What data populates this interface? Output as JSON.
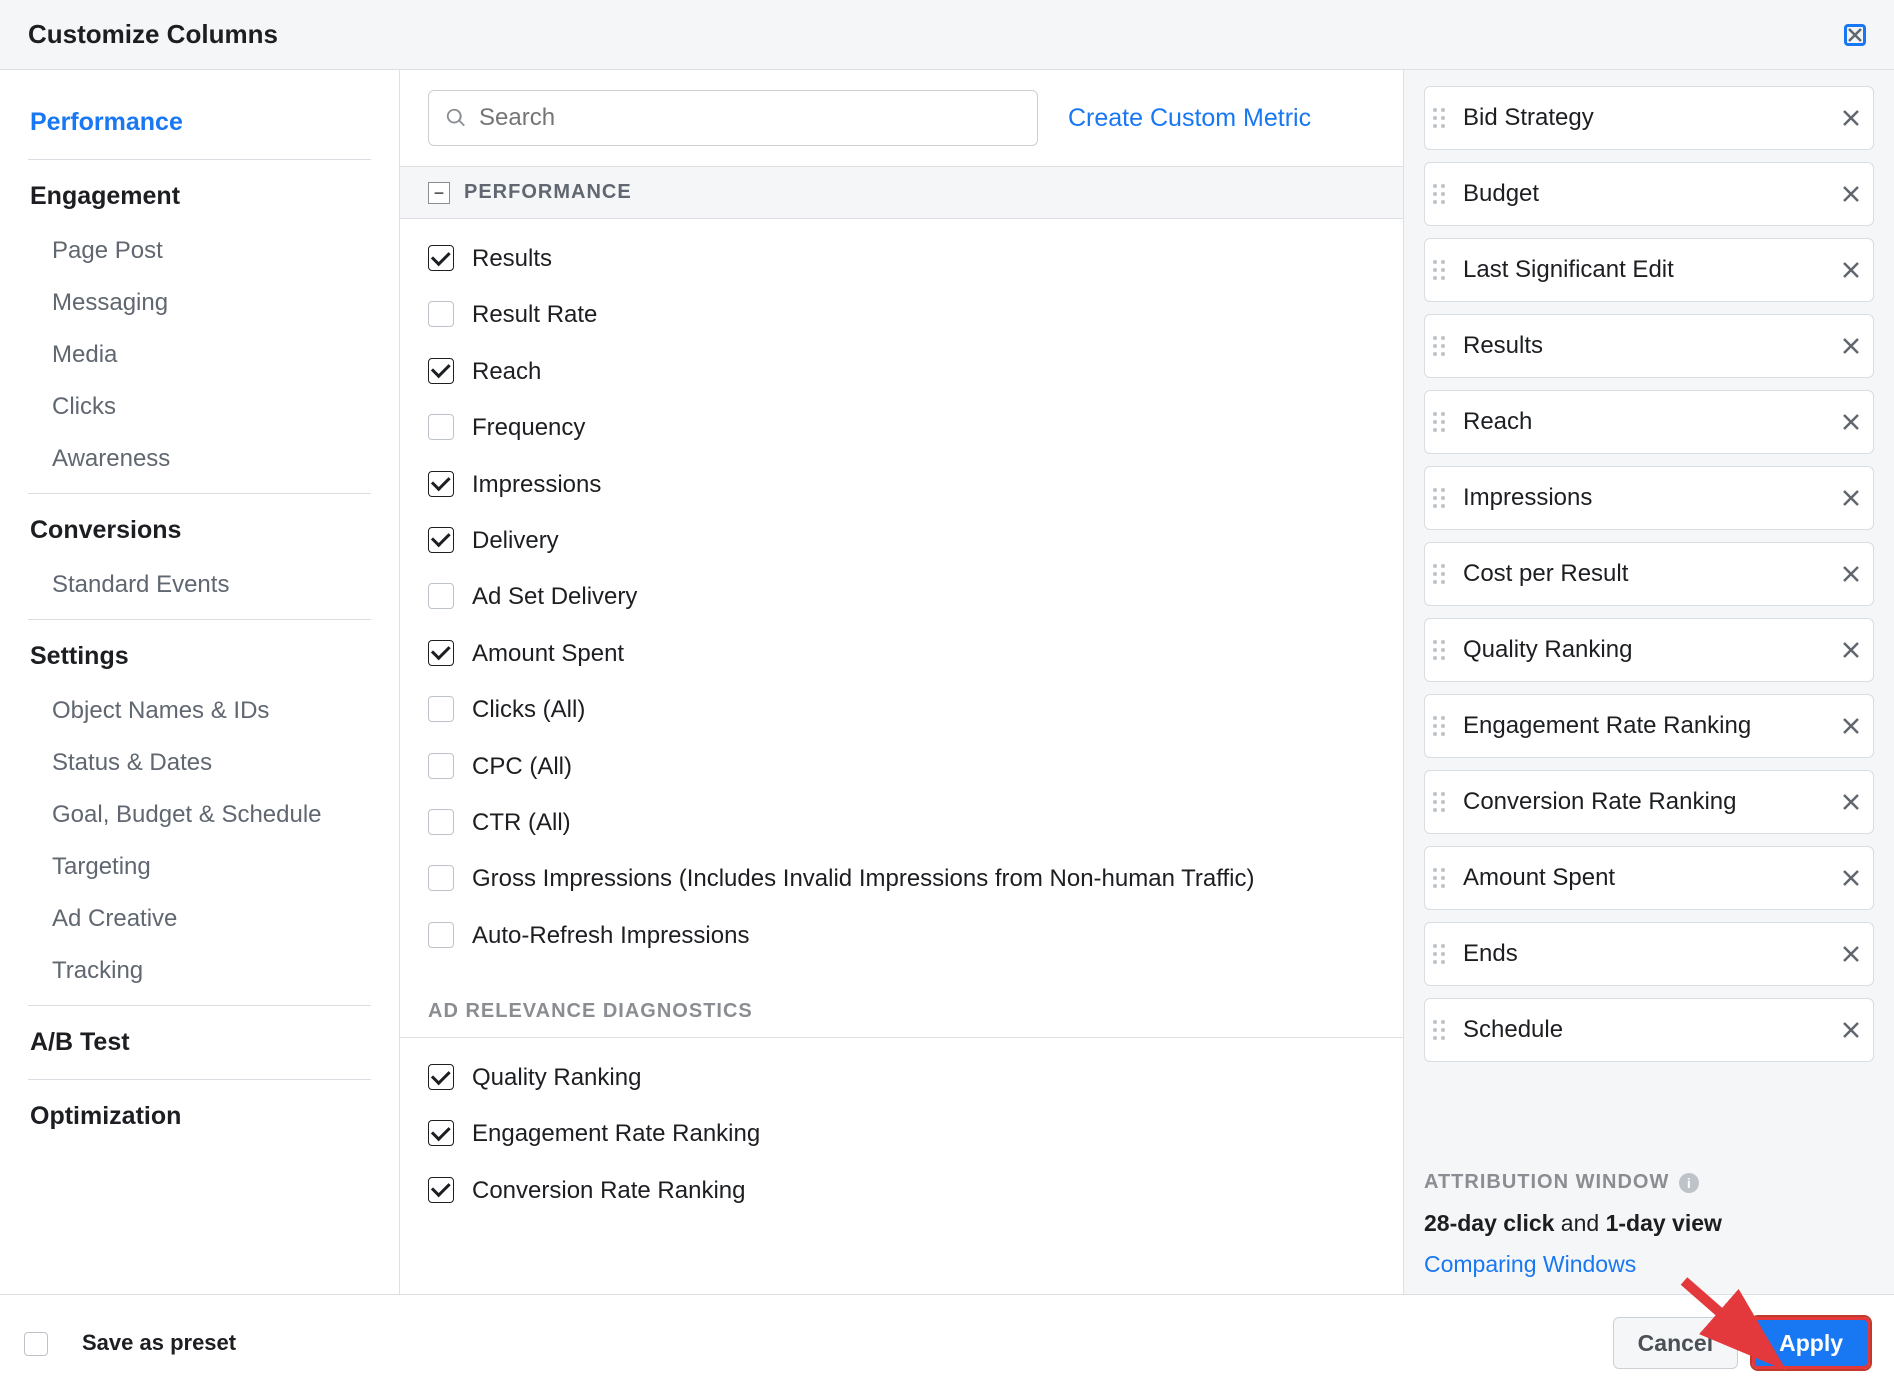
{
  "header": {
    "title": "Customize Columns"
  },
  "sidebar": {
    "categories": [
      {
        "label": "Performance",
        "active": true
      },
      {
        "label": "Engagement",
        "subs": [
          "Page Post",
          "Messaging",
          "Media",
          "Clicks",
          "Awareness"
        ]
      },
      {
        "label": "Conversions",
        "subs": [
          "Standard Events"
        ]
      },
      {
        "label": "Settings",
        "subs": [
          "Object Names & IDs",
          "Status & Dates",
          "Goal, Budget & Schedule",
          "Targeting",
          "Ad Creative",
          "Tracking"
        ]
      },
      {
        "label": "A/B Test"
      },
      {
        "label": "Optimization"
      }
    ]
  },
  "search": {
    "placeholder": "Search"
  },
  "create_link": "Create Custom Metric",
  "sections": [
    {
      "title": "PERFORMANCE",
      "collapsed": false,
      "style": "bar",
      "items": [
        {
          "label": "Results",
          "checked": true
        },
        {
          "label": "Result Rate",
          "checked": false
        },
        {
          "label": "Reach",
          "checked": true
        },
        {
          "label": "Frequency",
          "checked": false
        },
        {
          "label": "Impressions",
          "checked": true
        },
        {
          "label": "Delivery",
          "checked": true
        },
        {
          "label": "Ad Set Delivery",
          "checked": false
        },
        {
          "label": "Amount Spent",
          "checked": true
        },
        {
          "label": "Clicks (All)",
          "checked": false
        },
        {
          "label": "CPC (All)",
          "checked": false
        },
        {
          "label": "CTR (All)",
          "checked": false
        },
        {
          "label": "Gross Impressions (Includes Invalid Impressions from Non-human Traffic)",
          "checked": false
        },
        {
          "label": "Auto-Refresh Impressions",
          "checked": false
        }
      ]
    },
    {
      "title": "AD RELEVANCE DIAGNOSTICS",
      "style": "plain",
      "items": [
        {
          "label": "Quality Ranking",
          "checked": true
        },
        {
          "label": "Engagement Rate Ranking",
          "checked": true
        },
        {
          "label": "Conversion Rate Ranking",
          "checked": true
        }
      ]
    }
  ],
  "selected_columns": [
    "Bid Strategy",
    "Budget",
    "Last Significant Edit",
    "Results",
    "Reach",
    "Impressions",
    "Cost per Result",
    "Quality Ranking",
    "Engagement Rate Ranking",
    "Conversion Rate Ranking",
    "Amount Spent",
    "Ends",
    "Schedule"
  ],
  "attribution": {
    "title": "ATTRIBUTION WINDOW",
    "click_bold": "28-day click",
    "and_text": " and ",
    "view_bold": "1-day view",
    "link": "Comparing Windows"
  },
  "footer": {
    "preset": "Save as preset",
    "cancel": "Cancel",
    "apply": "Apply"
  }
}
